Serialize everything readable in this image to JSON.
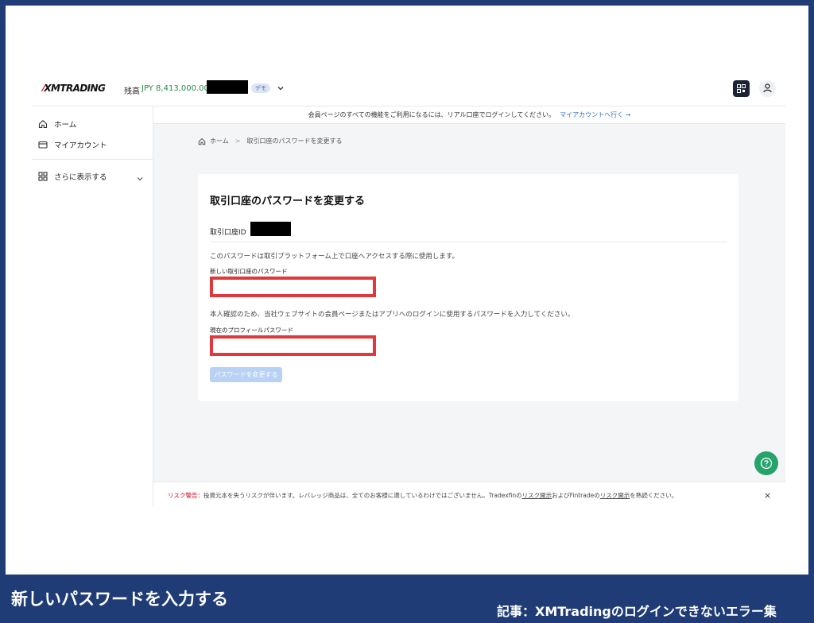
{
  "header": {
    "logo": "XMTRADING",
    "balance_label": "残高",
    "balance_value": "JPY 8,413,000.00",
    "account_badge": "デモ"
  },
  "sidebar": {
    "items": [
      {
        "label": "ホーム",
        "icon": "home-icon"
      },
      {
        "label": "マイアカウント",
        "icon": "wallet-icon"
      },
      {
        "label": "さらに表示する",
        "icon": "grid-icon"
      }
    ]
  },
  "notice": {
    "text": "会員ページのすべての機能をご利用になるには、リアル口座でログインしてください。",
    "link": "マイアカウントへ行く →"
  },
  "breadcrumb": {
    "home": "ホーム",
    "separator": ">",
    "current": "取引口座のパスワードを変更する"
  },
  "form": {
    "title": "取引口座のパスワードを変更する",
    "account_id_label": "取引口座ID",
    "description_1": "このパスワードは取引プラットフォーム上で口座へアクセスする際に使用します。",
    "new_password_label": "新しい取引口座のパスワード",
    "new_password_value": "",
    "description_2": "本人確認のため、当社ウェブサイトの会員ページまたはアプリへのログインに使用するパスワードを入力してください。",
    "current_password_label": "現在のプロフィールパスワード",
    "current_password_value": "",
    "submit_label": "パスワードを変更する"
  },
  "risk": {
    "warning_label": "リスク警告：",
    "text_1": "投資元本を失うリスクが伴います。レバレッジ商品は、全てのお客様に適しているわけではございません。Tradexfinの",
    "link_1": "リスク開示",
    "text_2": "およびFintradeの",
    "link_2": "リスク開示",
    "text_3": "を熟読ください。",
    "close": "×"
  },
  "caption": {
    "left": "新しいパスワードを入力する",
    "right": "記事：XMTradingのログインできないエラー集"
  },
  "colors": {
    "frame_bg": "#1f3c76",
    "highlight_red": "#e0383b",
    "help_green": "#26a36a",
    "balance_green": "#2a8a4a",
    "link_blue": "#2d6fcf"
  }
}
